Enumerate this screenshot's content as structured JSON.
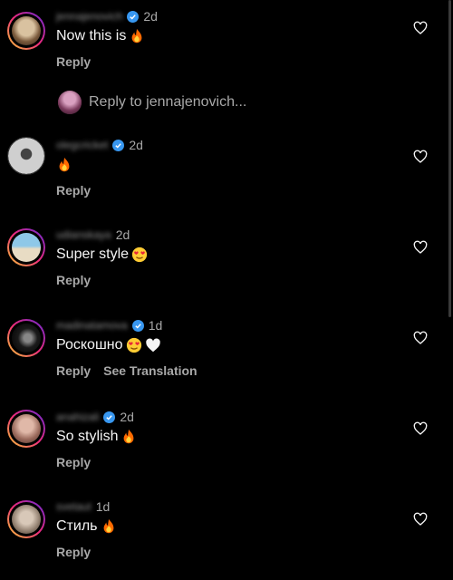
{
  "ui": {
    "reply_label": "Reply",
    "see_translation_label": "See Translation",
    "reply_to_text": "Reply to jennajenovich...",
    "accent_verified": "#3897f0",
    "background": "#000000"
  },
  "comments": [
    {
      "username": "jennajenovich",
      "verified": true,
      "time": "2d",
      "text": "Now this is",
      "emojis": [
        "fire-emoji"
      ]
    },
    {
      "username": "olegcricket",
      "verified": true,
      "time": "2d",
      "text": "",
      "emojis": [
        "fire-emoji"
      ]
    },
    {
      "username": "udianskaya",
      "verified": false,
      "time": "2d",
      "text": "Super style",
      "emojis": [
        "heart-eyes-emoji"
      ]
    },
    {
      "username": "madinatamova",
      "verified": true,
      "time": "1d",
      "text": "Роскошно",
      "emojis": [
        "heart-eyes-emoji",
        "white-heart-emoji"
      ],
      "translation": true
    },
    {
      "username": "anahizali",
      "verified": true,
      "time": "2d",
      "text": "So stylish",
      "emojis": [
        "fire-emoji"
      ]
    },
    {
      "username": "svetaut",
      "verified": false,
      "time": "1d",
      "text": "Стиль",
      "emojis": [
        "fire-emoji"
      ]
    }
  ]
}
